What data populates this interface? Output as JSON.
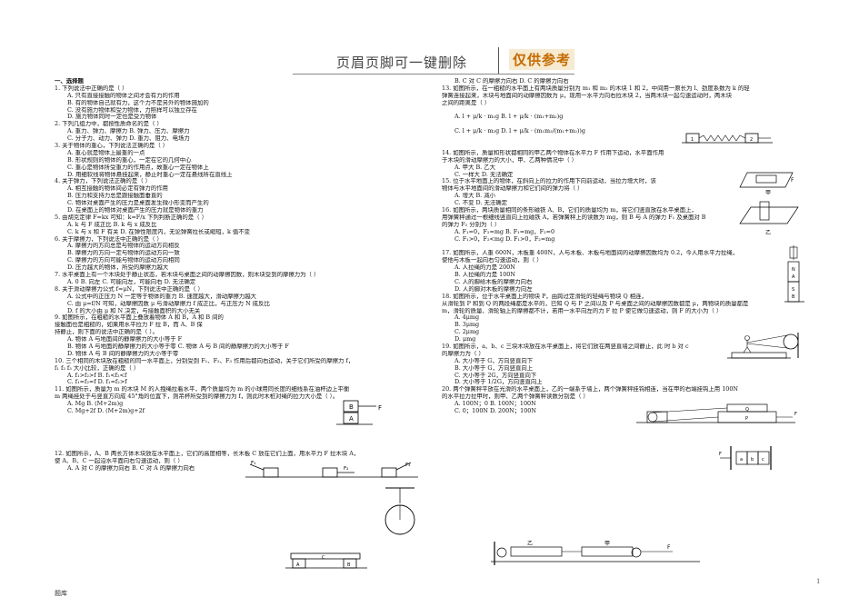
{
  "header": {
    "title": "页眉页脚可一键删除",
    "stamp": "仅供参考"
  },
  "left_lines": [
    "一、选择题",
    "1. 下列说法中正确的是（    ）",
    "A. 只有直接接触的物体之间才会有力的作用",
    "B. 有的物体自己就有力，这个力不是另外的物体施加的",
    "C. 没有施力物体和受力物体，力照样可以独立存在",
    "D. 施力物体同时一定也是受力物体",
    "2. 下列几组力中，都按性质命名的是（    ）",
    "A. 重力、弹力、摩擦力        B. 弹力、压力、摩擦力",
    "C. 分子力、动力、弹力        D. 重力、阻力、电场力",
    "3. 关于物体的重心，下列说法正确的是（    ）",
    "A. 重心就是物体上最重的一点",
    "B. 形状规则的物体的重心，一定在它的几何中心",
    "C. 重心是物体所受重力的作用点，故重心一定在物体上",
    "D. 用细软线将物体悬挂起来，静止时重心一定在悬线所在直线上",
    "4. 关于弹力，下列说法正确的是（    ）",
    "A. 相互接触的物体间必定有弹力的作用",
    "B. 压力和支持力总是跟接触面垂直的",
    "C. 物体对桌面产生的压力是桌面发生微小形变而产生的",
    "D. 在桌面上的物体对桌面产生的压力就是物体的重力",
    "5. 由胡克定律 F=kx 可知：k=F/x 下列判断正确的是（    ）",
    "A. k 与 F 成正比          B. k 与 x 成反比",
    "C. k 与 x 和 F 有关        D. 在弹性限度内，无论弹簧拉长或缩短，k 值不变",
    "6. 关于摩擦力，下列说法中正确的是（    ）",
    "A. 摩擦力的方向总是与物体的运动方向相反",
    "B. 摩擦力的方向一定与物体的运动方向一致",
    "C. 摩擦力的方向可能与物体的运动方向相同",
    "D. 压力越大的物体，所受的摩擦力越大",
    "7. 水平桌面上有一个木块处于静止状态，若木块与桌面之间的动摩擦因数，则木块受到的摩擦力为（    ）",
    "A. 0        B. 向左        C. 可能向左，可能向右        D. 无法确定",
    "8. 关于滑动摩擦力公式 f=μN，下列说法中正确的是（    ）",
    "A. 公式中的正压力 N 一定等于物体的重力        B. 速度越大，滑动摩擦力越大",
    "C. 由 μ=f/N 可知，动摩擦因数 μ 与滑动摩擦力 f 成正比，与正压力 N 成反比",
    "D. f 的大小由 μ 和 N 决定，与接触面积的大小无关",
    "9. 如图所示，在粗糙的水平面上叠放着物体 A 和 B，A 和 B 间的",
    "接触面也是粗糙的，如果用水平拉力 F 拉 B，而 A、B 保",
    "持静止，则下面的说法中正确的是（    ）。",
    "A. 物体 A 与地面间的静摩擦力的大小等于 F",
    "B. 物体 A 与地面的静摩擦力的大小等于零  C. 物体 A 与 B 间的静摩擦力的大小等于 F",
    "D. 物体 A 与 B 间的静摩擦力的大小等于零",
    "10. 三个相同的木块放在粗糙的同一水平面上，分别受到 F₁、F₂、F₃ 作用后都向右运动，关于它们所受的摩擦力 f，",
    "f₁ f₂ f₃ 大小比较，正确的是（    ）",
    "A. f₁>f₂>f        B. f₁<f₂<f",
    "C. f₁=f₂=f        D. f₁=f₂>f",
    "11. 如图所示，质量为 m 的木块 M 的人拽绳拉着水平，两个质量均为 m 的小球用同长度的细线系在油杯边上平衡",
    "m 两绳挂处于与竖直方向成 45°角的位置下，则吊杯所受到的摩擦力为 f，则此时木桩对绳的拉力大小是（    ）。",
    "A. Mg        B. (M+2m)g",
    "C. Mg+2f        D. (M+2m)g+2f",
    "",
    "",
    "",
    "",
    "",
    "12. 如图所示，A、B 两长方体木块放在水平面上，它们的高度相等，长木板 C 放在它们上面，用水平力 F 拉木块 A，",
    "使 A、B、C 一起沿水平面向右匀速运动，则（    ）",
    "A. A 对 C 的摩擦力向右        B. C 对 A 的摩擦力向右"
  ],
  "right_lines": [
    "B. C 对 C 的摩擦力向右        D. C 的摩擦力向右",
    "13. 如图所示，在一粗糙的水平面上有两块质量分别为 m₁ 和 m₂ 的木块 1 和 2，中间用一原长为 l、劲度系数为 k 的轻",
    "弹簧连接起来，木块与地面间的动摩擦因数为 μ，现用一水平力向右拉木块 2，当两木块一起匀速运动时，两木块",
    "之间的距离是（    ）",
    "",
    "A. l + μ/k · m₁g        B. l + μ/k · (m₁+m₂)g",
    "",
    "C. l + μ/k · m₂g        D. l + μ/k · (m₁m₂/(m₁+m₂))g",
    "",
    "",
    "14. 如图所示，质量和形状都相同的甲乙两个物体在水平力 F 作用下运动，水平面作用",
    "于木块的滑动摩擦力的大小，甲、乙两种情况中（    ）",
    "A. 甲大        B. 乙大",
    "C. 一样大        D. 无法确定",
    "15. 位于水平地面上的物体，在斜向上的拉力的作用下向前运动，当拉力增大时，该",
    "物体与水平地面间的滑动摩擦力和它们间的弹力将（    ）",
    "A. 增大        B. 减小",
    "C. 不变        D. 无法确定",
    "16. 如图所示，两块质量相同的条形磁铁 A、B，它们的质量均为 m，将它们竖直放在水平桌面上，",
    "用弹簧秤通过一根细线竖直向上拉磁铁 A，若弹簧秤上的读数为 mg，则 B 与 A 的弹力 F₁ 及桌面对 B",
    "的弹力 F₂ 分别为（    ）",
    "A. F₁=0，F₂=mg        B. F₁=mg，F₂=0",
    "C. F₁>0，F₂<mg        D. F₁>0，F₂=mg",
    "",
    "17. 如图所示，人重 600N，木板重 400N，人与木板、木板与地面间的动摩擦因数均为 0.2，今人用水平力拉绳，",
    "使他与木板一起向右匀速运动，则（    ）",
    "A. 人拉绳的力是 200N",
    "B. 人拉绳的力是 100N",
    "C. 人的脚给木板的摩擦力向右",
    "D. 人的脚对木板的摩擦力向左",
    "18. 如图所示，位于水平桌面上的物块 P，由跨过定滑轮的轻绳与物块 Q 相连，",
    "从滑轮到 P 和到 Q 的两段绳都是水平的，已知 Q 与 P 之间以及 P 与桌面之间的动摩擦因数都是 μ，两物块的质量都是",
    "m，滑轮的质量、滑轮轴上的摩擦都不计，若用一水平向左的力 F 拉 P 使它做匀速运动，则 F 的大小为（    ）",
    "A. 4μmg",
    "B. 3μmg",
    "C. 2μmg",
    "D. μmg",
    "19. 如图所示，a、b、c 三块木块放在水平桌面上，将它们放在两竖直墙之间静止，此                    时 b 对 c",
    "的摩擦力为（    ）",
    "A. 大小等于 G，方向竖直向下",
    "B. 大小等于 G，方向竖直向上",
    "C. 大小等于 2G，方向竖直向下",
    "D. 大小等于 1/2G，方向竖直向上",
    "20. 两个弹簧秤平放在光滑的水平桌面上，乙的一端系于墙上，两个弹簧秤挂钩相连，当在甲的右端挂钩上用 100N",
    "的水平拉力拉甲时，则甲、乙两个弹簧秤读数分别是（    ）",
    "A. 100N；0        B. 100N；100N",
    "C. 0；100N        D. 200N；100N"
  ],
  "figures": {
    "q9": {
      "a": "A",
      "b": "B",
      "f": "F"
    },
    "q10": {
      "f1": "F₁",
      "f2": "F₂",
      "f3": "F₃"
    },
    "q12": {
      "a": "A",
      "b": "B",
      "c": "C",
      "f": "F"
    },
    "q13": {
      "m1": "1",
      "m2": "2"
    },
    "q14": {
      "jia": "甲",
      "yi": "乙",
      "f": "F"
    },
    "q16": {
      "label": "弹簧秤",
      "a": "A",
      "b": "B",
      "n": "N",
      "s": "S"
    },
    "q18": {
      "p": "P",
      "q": "Q",
      "f": "F"
    },
    "q19": {
      "f": "F",
      "a": "a",
      "b": "b",
      "c": "c"
    },
    "q20": {
      "yi": "乙",
      "jia": "甲",
      "f": "F"
    }
  },
  "footer": {
    "left": "题库",
    "page": "1"
  }
}
